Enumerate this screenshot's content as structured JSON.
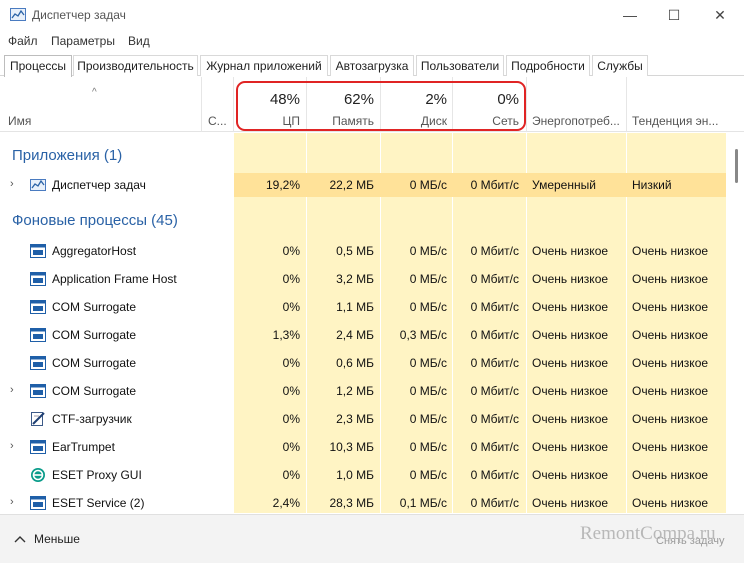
{
  "window": {
    "title": "Диспетчер задач",
    "minimize": "—",
    "maximize": "☐",
    "close": "✕"
  },
  "menu": [
    "Файл",
    "Параметры",
    "Вид"
  ],
  "tabs": [
    "Процессы",
    "Производительность",
    "Журнал приложений",
    "Автозагрузка",
    "Пользователи",
    "Подробности",
    "Службы"
  ],
  "header": {
    "name": "Имя",
    "status": "С...",
    "cpu_pct": "48%",
    "cpu": "ЦП",
    "mem_pct": "62%",
    "mem": "Память",
    "disk_pct": "2%",
    "disk": "Диск",
    "net_pct": "0%",
    "net": "Сеть",
    "power": "Энергопотреб...",
    "power_trend": "Тенденция эн..."
  },
  "groups": {
    "apps": "Приложения (1)",
    "background": "Фоновые процессы (45)"
  },
  "processes": [
    {
      "name": "Диспетчер задач",
      "expand": "›",
      "icon": "task-manager-icon",
      "cpu": "19,2%",
      "mem": "22,2 МБ",
      "disk": "0 МБ/с",
      "net": "0 Мбит/с",
      "power": "Умеренный",
      "trend": "Низкий"
    },
    {
      "name": "AggregatorHost",
      "expand": "",
      "icon": "window-icon",
      "cpu": "0%",
      "mem": "0,5 МБ",
      "disk": "0 МБ/с",
      "net": "0 Мбит/с",
      "power": "Очень низкое",
      "trend": "Очень низкое"
    },
    {
      "name": "Application Frame Host",
      "expand": "",
      "icon": "window-icon",
      "cpu": "0%",
      "mem": "3,2 МБ",
      "disk": "0 МБ/с",
      "net": "0 Мбит/с",
      "power": "Очень низкое",
      "trend": "Очень низкое"
    },
    {
      "name": "COM Surrogate",
      "expand": "",
      "icon": "window-icon",
      "cpu": "0%",
      "mem": "1,1 МБ",
      "disk": "0 МБ/с",
      "net": "0 Мбит/с",
      "power": "Очень низкое",
      "trend": "Очень низкое"
    },
    {
      "name": "COM Surrogate",
      "expand": "",
      "icon": "window-icon",
      "cpu": "1,3%",
      "mem": "2,4 МБ",
      "disk": "0,3 МБ/с",
      "net": "0 Мбит/с",
      "power": "Очень низкое",
      "trend": "Очень низкое"
    },
    {
      "name": "COM Surrogate",
      "expand": "",
      "icon": "window-icon",
      "cpu": "0%",
      "mem": "0,6 МБ",
      "disk": "0 МБ/с",
      "net": "0 Мбит/с",
      "power": "Очень низкое",
      "trend": "Очень низкое"
    },
    {
      "name": "COM Surrogate",
      "expand": "›",
      "icon": "window-icon",
      "cpu": "0%",
      "mem": "1,2 МБ",
      "disk": "0 МБ/с",
      "net": "0 Мбит/с",
      "power": "Очень низкое",
      "trend": "Очень низкое"
    },
    {
      "name": "CTF-загрузчик",
      "expand": "",
      "icon": "pen-icon",
      "cpu": "0%",
      "mem": "2,3 МБ",
      "disk": "0 МБ/с",
      "net": "0 Мбит/с",
      "power": "Очень низкое",
      "trend": "Очень низкое"
    },
    {
      "name": "EarTrumpet",
      "expand": "›",
      "icon": "window-icon",
      "cpu": "0%",
      "mem": "10,3 МБ",
      "disk": "0 МБ/с",
      "net": "0 Мбит/с",
      "power": "Очень низкое",
      "trend": "Очень низкое"
    },
    {
      "name": "ESET Proxy GUI",
      "expand": "",
      "icon": "eset-icon",
      "cpu": "0%",
      "mem": "1,0 МБ",
      "disk": "0 МБ/с",
      "net": "0 Мбит/с",
      "power": "Очень низкое",
      "trend": "Очень низкое"
    },
    {
      "name": "ESET Service (2)",
      "expand": "›",
      "icon": "window-icon",
      "cpu": "2,4%",
      "mem": "28,3 МБ",
      "disk": "0,1 МБ/с",
      "net": "0 Мбит/с",
      "power": "Очень низкое",
      "trend": "Очень низкое"
    }
  ],
  "footer": {
    "fewer": "Меньше",
    "end_task": "Снять задачу",
    "watermark": "RemontCompa.ru"
  },
  "colors": {
    "accent": "#2a62a6",
    "highlight": "#e02424",
    "heat_low": "#fff4c4",
    "heat_mid": "#ffe299"
  }
}
